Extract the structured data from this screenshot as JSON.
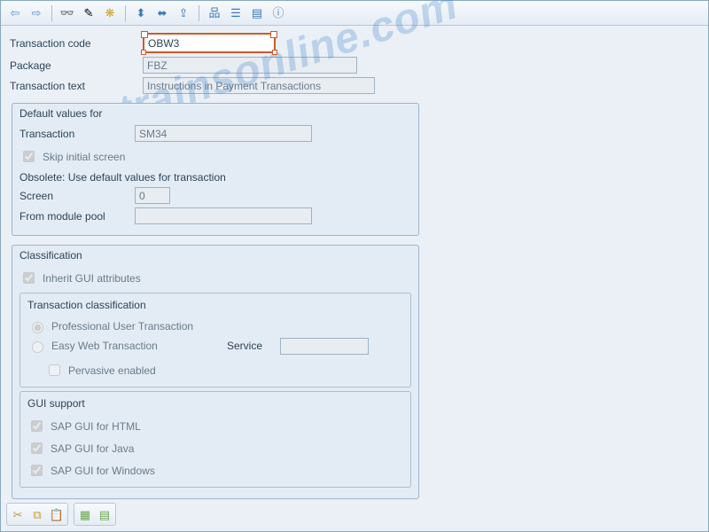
{
  "header": {
    "transaction_code_label": "Transaction code",
    "transaction_code_value": "OBW3",
    "package_label": "Package",
    "package_value": "FBZ",
    "transaction_text_label": "Transaction text",
    "transaction_text_value": "Instructions in Payment Transactions"
  },
  "defaults": {
    "group_title": "Default values for",
    "transaction_label": "Transaction",
    "transaction_value": "SM34",
    "skip_initial_label": "Skip initial screen",
    "obsolete_text": "Obsolete: Use default values for transaction",
    "screen_label": "Screen",
    "screen_value": "0",
    "module_pool_label": "From module pool",
    "module_pool_value": ""
  },
  "classification": {
    "group_title": "Classification",
    "inherit_label": "Inherit GUI attributes",
    "trans_class_title": "Transaction classification",
    "professional_label": "Professional User Transaction",
    "easy_web_label": "Easy Web Transaction",
    "service_label": "Service",
    "service_value": "",
    "pervasive_label": "Pervasive enabled",
    "gui_support_title": "GUI support",
    "gui_html_label": "SAP GUI for HTML",
    "gui_java_label": "SAP GUI for Java",
    "gui_win_label": "SAP GUI for Windows"
  },
  "watermark": "saptrainsonline.com"
}
